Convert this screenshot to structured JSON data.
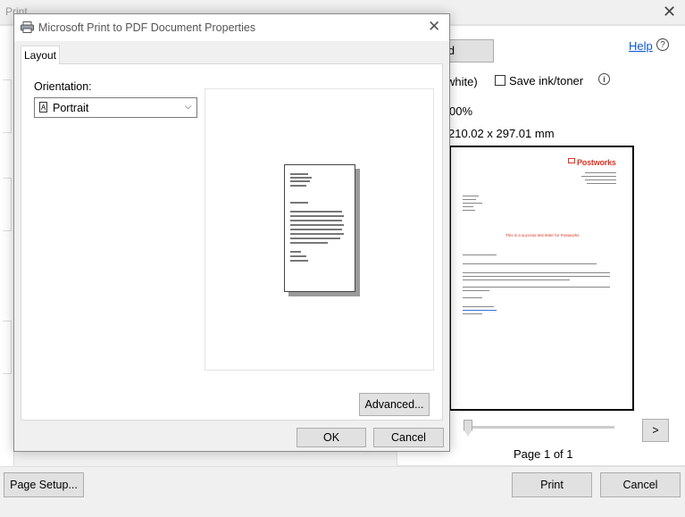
{
  "background_window": {
    "title": "Print",
    "close_glyph": "✕",
    "hidden_button_label": "d",
    "help_label": "Help",
    "help_icon": "?",
    "color_mode_text": "white)",
    "save_ink_label": "Save ink/toner",
    "info_icon": "i",
    "zoom_text": "00%",
    "paper_size_text": "210.02 x 297.01 mm",
    "next_page_label": ">",
    "page_indicator": "Page 1 of 1",
    "page_setup_label": "Page Setup...",
    "print_label": "Print",
    "cancel_label": "Cancel",
    "preview_doc": {
      "logo_text": "Postworks",
      "headline": "This is a success test letter for Postworks"
    }
  },
  "dialog": {
    "title": "Microsoft Print to PDF Document Properties",
    "close_glyph": "✕",
    "tab_layout": "Layout",
    "orientation_label": "Orientation:",
    "orientation_value": "Portrait",
    "orientation_glyph": "A",
    "chevron_glyph": "⌵",
    "advanced_label": "Advanced...",
    "ok_label": "OK",
    "cancel_label": "Cancel"
  },
  "icons": {
    "printer": "printer-icon",
    "chevron": "chevron-down-icon",
    "help": "help-icon",
    "info": "info-icon",
    "close": "close-icon"
  },
  "colors": {
    "link": "#0b57d0",
    "brand_red": "#dd3322",
    "button_face": "#e1e1e1"
  }
}
